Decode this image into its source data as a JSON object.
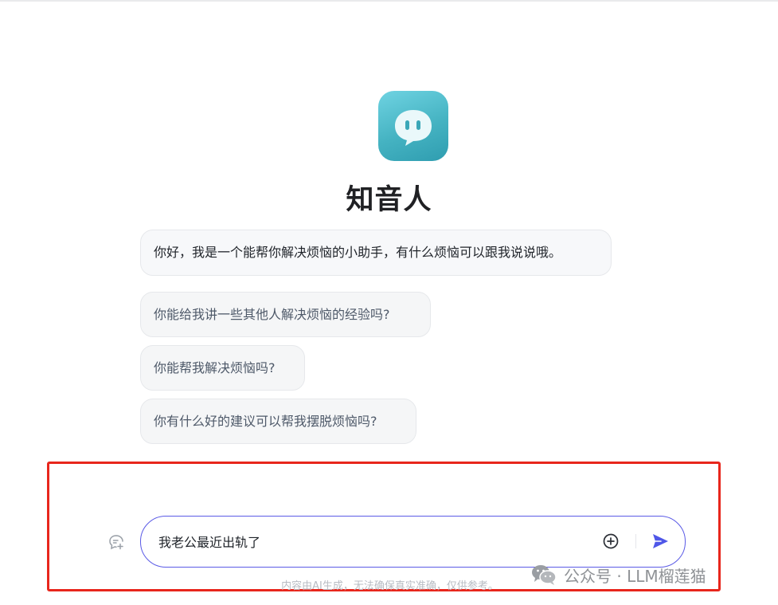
{
  "bot": {
    "name": "知音人",
    "greeting": "你好，我是一个能帮你解决烦恼的小助手，有什么烦恼可以跟我说说哦。",
    "accent_color": "#45b3c2"
  },
  "suggestions": [
    "你能给我讲一些其他人解决烦恼的经验吗?",
    "你能帮我解决烦恼吗?",
    "你有什么好的建议可以帮我摆脱烦恼吗?"
  ],
  "composer": {
    "value": "我老公最近出轨了",
    "send_color": "#4f57e8",
    "border_color": "#5b5be6"
  },
  "disclaimer": "内容由AI生成，无法确保真实准确，仅供参考。",
  "watermark": {
    "text": "公众号 · LLM榴莲猫"
  },
  "highlight_color": "#e8261c"
}
